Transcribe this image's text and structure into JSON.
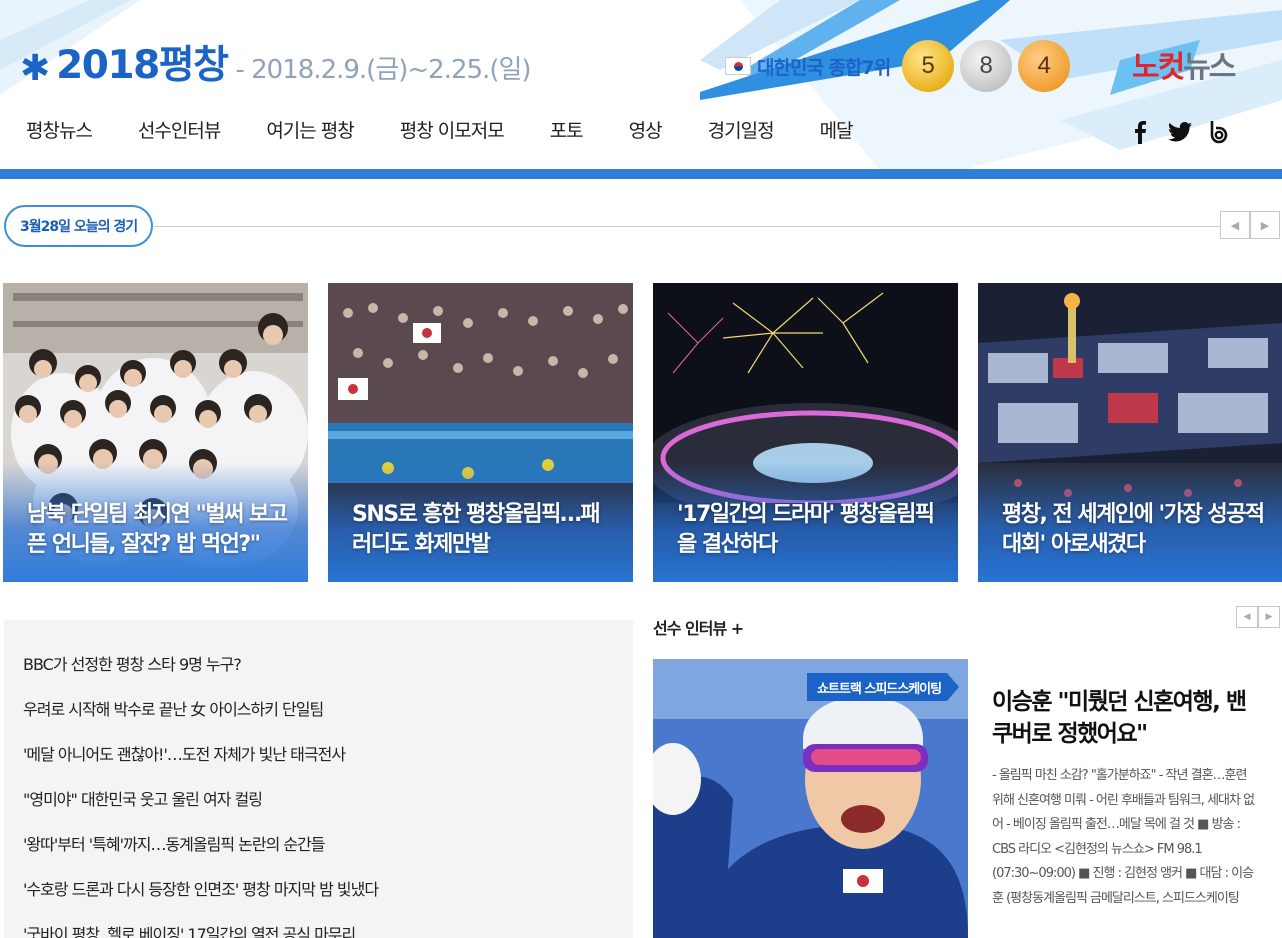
{
  "brand": {
    "title": "2018평창",
    "dates": "- 2018.2.9.(금)~2.25.(일)"
  },
  "medals": {
    "rank_label": "대한민국 종합7위",
    "gold": "5",
    "silver": "8",
    "bronze": "4"
  },
  "logo": {
    "part1": "노컷",
    "part2": "뉴스"
  },
  "nav": [
    "평창뉴스",
    "선수인터뷰",
    "여기는 평창",
    "평창 이모저모",
    "포토",
    "영상",
    "경기일정",
    "메달"
  ],
  "colors": {
    "accent": "#1b63c6",
    "header_line": "#2f7fd8",
    "logo_red": "#e0262c"
  },
  "today": {
    "label": "3월28일 오늘의 경기"
  },
  "cards": [
    {
      "caption": "남북 단일팀 최지연 \"벌써 보고픈 언니들, 잘잔? 밥 먹언?\""
    },
    {
      "caption": "SNS로 흥한 평창올림픽…패러디도 화제만발"
    },
    {
      "caption": "'17일간의 드라마' 평창올림픽을 결산하다"
    },
    {
      "caption": "평창, 전 세계인에 '가장 성공적 대회' 아로새겼다"
    }
  ],
  "news": [
    "BBC가 선정한 평창 스타 9명 누구?",
    "우려로 시작해 박수로 끝난 女 아이스하키 단일팀",
    "'메달 아니어도 괜찮아!'…도전 자체가 빛난 태극전사",
    "\"영미야\" 대한민국 웃고 울린 여자 컬링",
    "'왕따'부터 '특혜'까지…동계올림픽 논란의 순간들",
    "'수호랑 드론과 다시 등장한 인면조' 평창 마지막 밤 빛냈다",
    "'굿바이 평창, 헬로 베이징' 17일간의 열전 공식 마무리"
  ],
  "interview": {
    "section_title": "선수 인터뷰 +",
    "tag": "쇼트트랙 스피드스케이팅",
    "headline": "이승훈 \"미뤘던 신혼여행, 밴쿠버로 정했어요\"",
    "body": "- 올림픽 마친 소감? \"홀가분하죠\" - 작년 결혼…훈련 위해 신혼여행 미뤄 - 어린 후배들과 팀워크, 세대차 없어 - 베이징 올림픽 출전…메달 목에 걸 것 ■ 방송 : CBS 라디오 <김현정의 뉴스쇼> FM 98.1 (07:30~09:00) ■ 진행 : 김현정 앵커 ■ 대담 : 이승훈 (평창동계올림픽 금메달리스트, 스피드스케이팅"
  }
}
